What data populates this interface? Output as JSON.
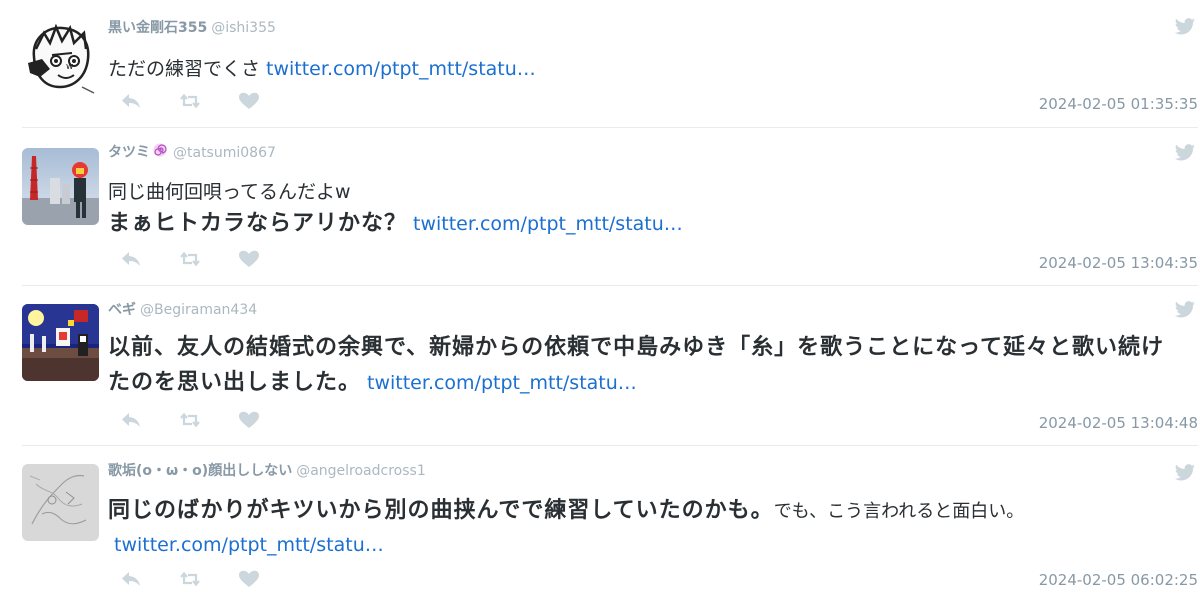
{
  "colors": {
    "accent_link": "#1b6fd1",
    "muted_text": "#8899a6",
    "divider": "#e6ecf0",
    "icon": "#ccd6dd"
  },
  "tweets": [
    {
      "name": "黒い金剛石355",
      "handle": "@ishi355",
      "body_text": "ただの練習でくさ",
      "link": "twitter.com/ptpt_mtt/statu…",
      "timestamp": "2024-02-05 01:35:35",
      "avatar_icon": "manga-face-avatar"
    },
    {
      "name": "タツミ",
      "name_badge_icon": "spiral-emoji-icon",
      "handle": "@tatsumi0867",
      "body_text": "同じ曲何回唄ってるんだよw",
      "body_bold": "まぁヒトカラならアリかな？",
      "link": "twitter.com/ptpt_mtt/statu…",
      "timestamp": "2024-02-05 13:04:35",
      "avatar_icon": "port-tower-photo-avatar"
    },
    {
      "name": "ベギ",
      "handle": "@Begiraman434",
      "body_bold": "以前、友人の結婚式の余興で、新婦からの依頼で中島みゆき「糸」を歌うことになって延々と歌い続けたのを思い出しました。",
      "link": "twitter.com/ptpt_mtt/statu…",
      "timestamp": "2024-02-05 13:04:48",
      "avatar_icon": "night-scene-pixel-avatar"
    },
    {
      "name": "歌垢(o・ω・o)顔出ししない",
      "handle": "@angelroadcross1",
      "body_bold": "同じのばかりがキツいから別の曲挟んでで練習していたのかも。",
      "body_text": "でも、こう言われると面白い。",
      "link": "twitter.com/ptpt_mtt/statu…",
      "timestamp": "2024-02-05 06:02:25",
      "avatar_icon": "pencil-sketch-avatar"
    }
  ],
  "actions": {
    "reply_icon": "reply-icon",
    "retweet_icon": "retweet-icon",
    "like_icon": "heart-icon"
  },
  "brand_icon": "twitter-bird-icon"
}
